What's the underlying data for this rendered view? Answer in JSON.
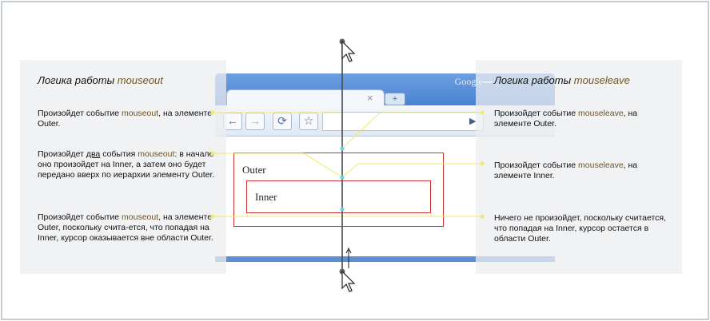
{
  "browser": {
    "brand": "Google",
    "tab_close": "×",
    "new_tab": "+",
    "back": "←",
    "forward": "→",
    "reload": "⟳",
    "star": "☆",
    "go": "▶"
  },
  "boxes": {
    "outer": "Outer",
    "inner": "Inner"
  },
  "left": {
    "title_prefix": "Логика работы",
    "title_event": "mouseout",
    "item1": {
      "pre": "Произойдет событие ",
      "ev": "mouseout",
      "post": ", на элементе Outer."
    },
    "item2": {
      "pre": "Произойдет ",
      "u": "два",
      "mid": " события ",
      "ev": "mouseout",
      "post": ": в начале оно произойдет на Inner, а затем оно будет передано вверх по иерархии элементу Outer."
    },
    "item3": {
      "pre": "Произойдет событие ",
      "ev": "mouseout",
      "post": ", на элементе Outer, поскольку счита-ется, что попадая на Inner,  курсор оказывается вне области Outer."
    }
  },
  "right": {
    "title_prefix": "Логика работы",
    "title_event": "mouseleave",
    "item1": {
      "pre": "Произойдет событие ",
      "ev": "mouseleave",
      "post": ", на элементе Outer."
    },
    "item2": {
      "pre": "Произойдет событие ",
      "ev": "mouseleave",
      "post": ", на элементе Inner."
    },
    "item3": {
      "text": "Ничего не произойдет, поскольку считается, что попадая на Inner, курсор остается в области Outer."
    }
  },
  "colors": {
    "accent_event": "#6d5423",
    "connector": "#f3e86a",
    "dot_cyan": "#5fd3e6",
    "box_border": "#cc3333"
  },
  "icons": [
    "cursor-top-icon",
    "cursor-bottom-icon",
    "arrow-up-icon"
  ]
}
